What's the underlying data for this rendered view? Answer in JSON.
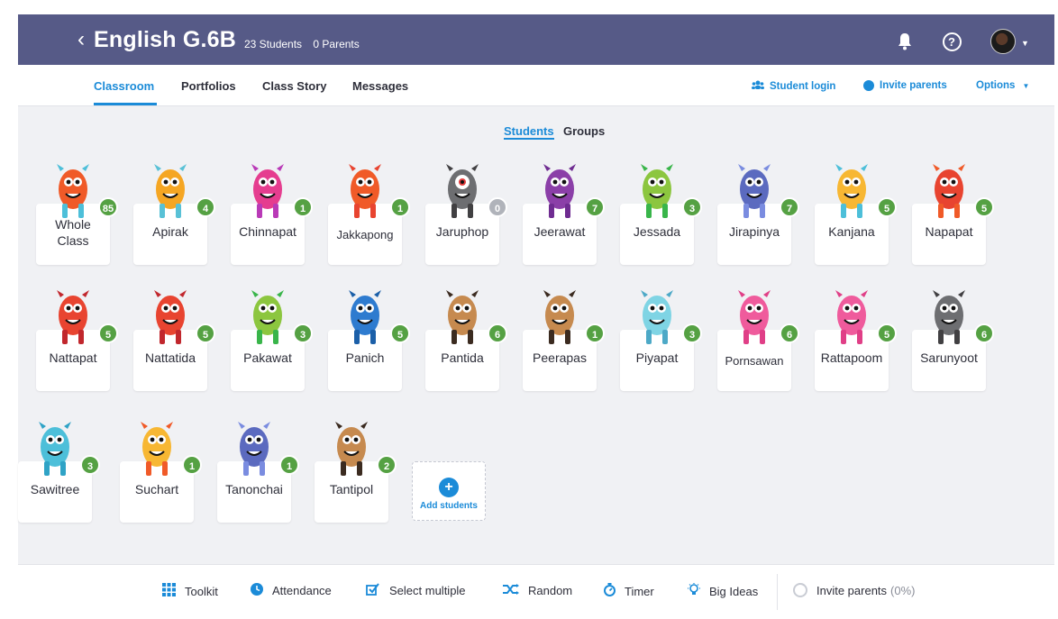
{
  "header": {
    "class_name": "English G.6B",
    "students_count": "23 Students",
    "parents_count": "0 Parents"
  },
  "tabs": [
    {
      "label": "Classroom"
    },
    {
      "label": "Portfolios"
    },
    {
      "label": "Class Story"
    },
    {
      "label": "Messages"
    }
  ],
  "right_links": {
    "student_login": "Student login",
    "invite_parents": "Invite parents",
    "options": "Options"
  },
  "view_toggle": {
    "students": "Students",
    "groups": "Groups"
  },
  "whole_class": {
    "name": "Whole Class",
    "points": "85"
  },
  "students": [
    {
      "name": "Apirak",
      "points": "4"
    },
    {
      "name": "Chinnapat",
      "points": "1"
    },
    {
      "name": "Jakkapong",
      "points": "1"
    },
    {
      "name": "Jaruphop",
      "points": "0"
    },
    {
      "name": "Jeerawat",
      "points": "7"
    },
    {
      "name": "Jessada",
      "points": "3"
    },
    {
      "name": "Jirapinya",
      "points": "7"
    },
    {
      "name": "Kanjana",
      "points": "5"
    },
    {
      "name": "Napapat",
      "points": "5"
    },
    {
      "name": "Nattapat",
      "points": "5"
    },
    {
      "name": "Nattatida",
      "points": "5"
    },
    {
      "name": "Pakawat",
      "points": "3"
    },
    {
      "name": "Panich",
      "points": "5"
    },
    {
      "name": "Pantida",
      "points": "6"
    },
    {
      "name": "Peerapas",
      "points": "1"
    },
    {
      "name": "Piyapat",
      "points": "3"
    },
    {
      "name": "Pornsawan",
      "points": "6"
    },
    {
      "name": "Rattapoom",
      "points": "5"
    },
    {
      "name": "Sarunyoot",
      "points": "6"
    },
    {
      "name": "Sawitree",
      "points": "3"
    },
    {
      "name": "Suchart",
      "points": "1"
    },
    {
      "name": "Tanonchai",
      "points": "1"
    },
    {
      "name": "Tantipol",
      "points": "2"
    }
  ],
  "add_students": {
    "label": "Add students"
  },
  "toolbar": {
    "toolkit": "Toolkit",
    "attendance": "Attendance",
    "select_multiple": "Select multiple",
    "random": "Random",
    "timer": "Timer",
    "big_ideas": "Big Ideas",
    "invite_parents": "Invite parents",
    "invite_percent": "(0%)"
  },
  "colors": {
    "header_bg": "#565a87",
    "accent": "#1b8bd8",
    "badge_green": "#55a143",
    "badge_gray": "#b0b3ba"
  }
}
